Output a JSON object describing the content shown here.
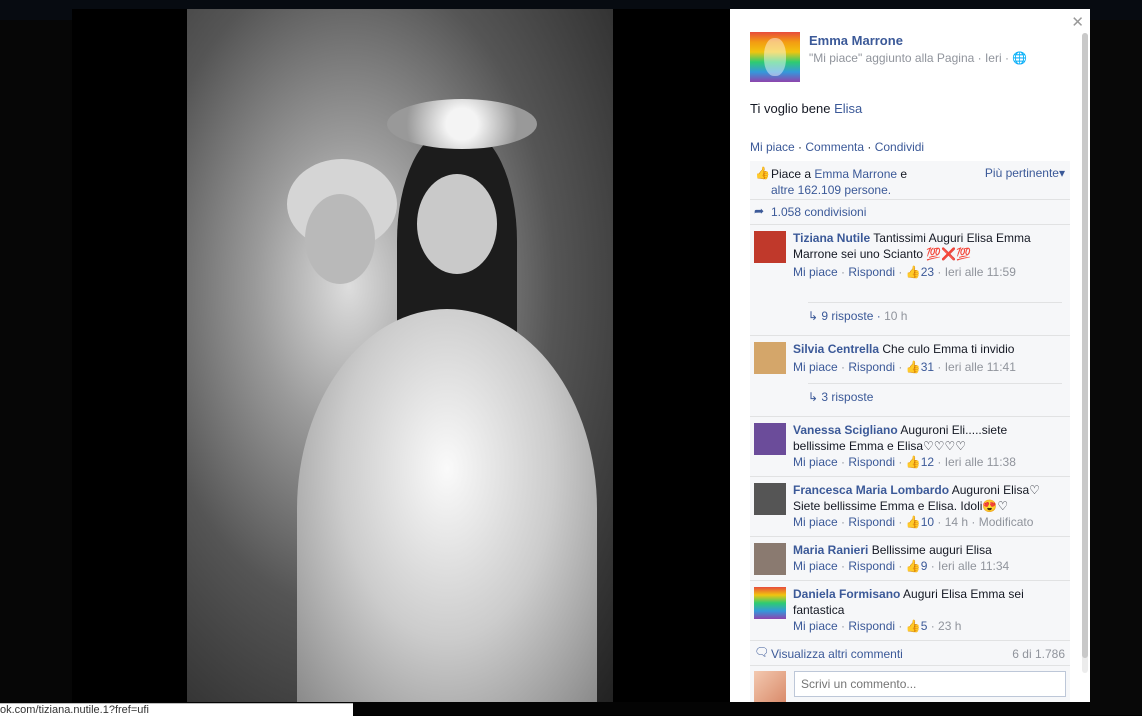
{
  "post": {
    "author": "Emma Marrone",
    "meta": "\"Mi piace\" aggiunto alla Pagina · Ieri ·",
    "text_prefix": "Ti voglio bene ",
    "text_tag": "Elisa",
    "actions": {
      "like": "Mi piace",
      "sep1": " · ",
      "comment": "Commenta",
      "sep2": " · ",
      "share": "Condividi"
    }
  },
  "ufi": {
    "likes_prefix": "Piace a ",
    "likes_name": "Emma Marrone",
    "likes_mid": " e",
    "likes_rest": "altre 162.109 persone.",
    "sort_label": "Più pertinente",
    "shares": "1.058 condivisioni"
  },
  "comments": [
    {
      "name": "Tiziana Nutile",
      "text": "Tantissimi Auguri Elisa Emma Marrone sei uno Scianto 💯❌💯",
      "reply": "Rispondi",
      "like": "Mi piace",
      "likes": "23",
      "time": "Ieri alle 11:59",
      "replies": "9 risposte",
      "replies_time": "10 h",
      "color": "#c0392b"
    },
    {
      "name": "Silvia Centrella",
      "text": "Che culo Emma ti invidio",
      "reply": "Rispondi",
      "like": "Mi piace",
      "likes": "31",
      "time": "Ieri alle 11:41",
      "replies": "3 risposte",
      "replies_time": "",
      "color": "#d4a66a"
    },
    {
      "name": "Vanessa Scigliano",
      "text": "Auguroni Eli.....siete bellissime Emma e Elisa♡♡♡♡",
      "reply": "Rispondi",
      "like": "Mi piace",
      "likes": "12",
      "time": "Ieri alle 11:38",
      "color": "#6b4c9a"
    },
    {
      "name": "Francesca Maria Lombardo",
      "text": "Auguroni Elisa♡ Siete bellissime Emma e Elisa. Idoli😍♡",
      "reply": "Rispondi",
      "like": "Mi piace",
      "likes": "10",
      "time": "14 h · Modificato",
      "color": "#555555"
    },
    {
      "name": "Maria Ranieri",
      "text": "Bellissime auguri Elisa",
      "reply": "Rispondi",
      "like": "Mi piace",
      "likes": "9",
      "time": "Ieri alle 11:34",
      "color": "#8a7a70"
    },
    {
      "name": "Daniela Formisano",
      "text": "Auguri Elisa Emma sei fantastica",
      "reply": "Rispondi",
      "like": "Mi piace",
      "likes": "5",
      "time": "23 h",
      "color": "#2ecc71"
    }
  ],
  "more": {
    "label": "Visualizza altri commenti",
    "count": "6 di 1.786"
  },
  "compose": {
    "placeholder": "Scrivi un commento..."
  },
  "status_url": "ok.com/tiziana.nutile.1?fref=ufi"
}
